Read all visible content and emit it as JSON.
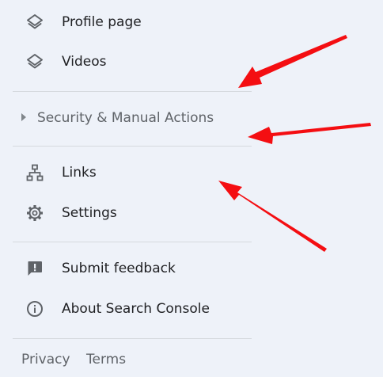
{
  "nav_top": [
    {
      "label": "Profile page",
      "icon": "layers-icon"
    },
    {
      "label": "Videos",
      "icon": "layers-icon"
    }
  ],
  "section": {
    "label": "Security & Manual Actions",
    "icon": "caret-right-icon"
  },
  "nav_middle": [
    {
      "label": "Links",
      "icon": "sitemap-icon"
    },
    {
      "label": "Settings",
      "icon": "gear-icon"
    }
  ],
  "nav_bottom": [
    {
      "label": "Submit feedback",
      "icon": "feedback-icon"
    },
    {
      "label": "About Search Console",
      "icon": "info-icon"
    }
  ],
  "footer": {
    "privacy": "Privacy",
    "terms": "Terms"
  },
  "annotation_color": "#f40e12",
  "icon_color": "#5f6368"
}
